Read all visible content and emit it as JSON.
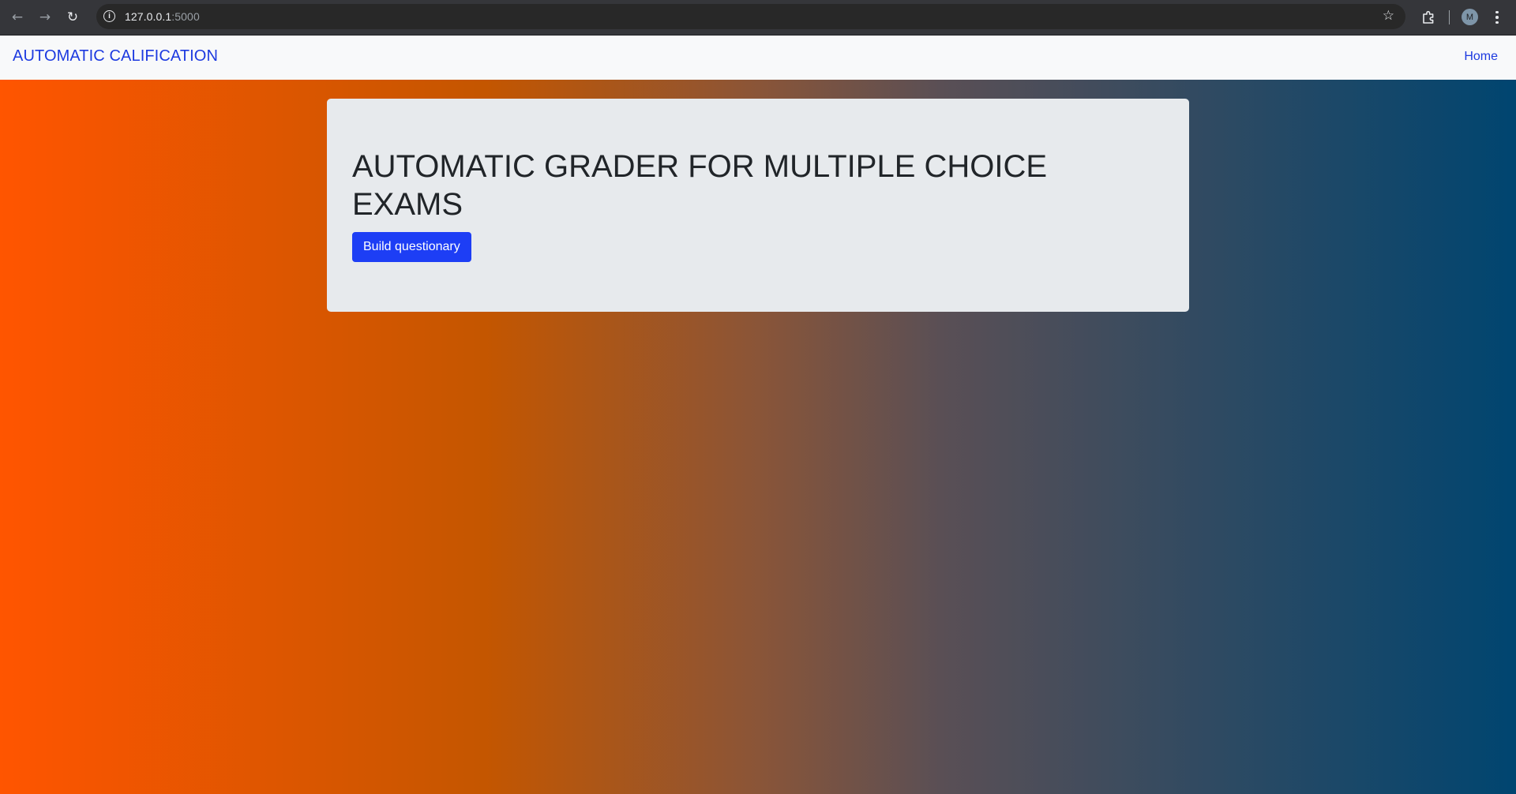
{
  "browser": {
    "url_host": "127.0.0.1",
    "url_port": ":5000",
    "avatar_initial": "M",
    "icons": {
      "back": "arrow-left-icon",
      "forward": "arrow-right-icon",
      "reload": "reload-icon",
      "site_info": "info-icon",
      "bookmark": "star-icon",
      "extensions": "puzzle-icon",
      "menu": "kebab-menu-icon"
    }
  },
  "navbar": {
    "brand": "AUTOMATIC CALIFICATION",
    "home_label": "Home"
  },
  "jumbotron": {
    "title": "AUTOMATIC GRADER FOR MULTIPLE CHOICE EXAMS",
    "button_label": "Build questionary"
  },
  "colors": {
    "accent": "#1d3ef5",
    "link": "#1d3ae0",
    "gradient_start": "#ff5500",
    "gradient_end": "#004570"
  }
}
